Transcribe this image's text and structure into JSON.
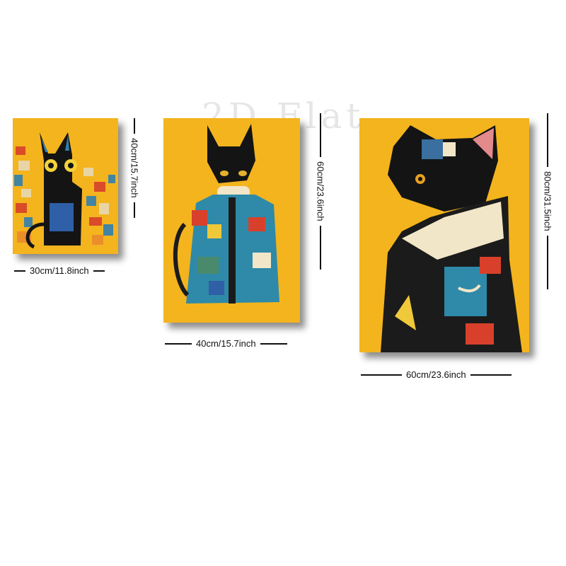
{
  "watermark": "2D Flat",
  "paintings": [
    {
      "name": "small-cat-painting",
      "width_label": "30cm/11.8inch",
      "height_label": "40cm/15.7inch"
    },
    {
      "name": "medium-cat-painting",
      "width_label": "40cm/15.7inch",
      "height_label": "60cm/23.6inch"
    },
    {
      "name": "large-cat-painting",
      "width_label": "60cm/23.6inch",
      "height_label": "80cm/31.5inch"
    }
  ],
  "colors": {
    "background": "#f4b41e",
    "cat": "#141414",
    "patch_blue": "#2f7fb0",
    "patch_red": "#d8402b"
  }
}
